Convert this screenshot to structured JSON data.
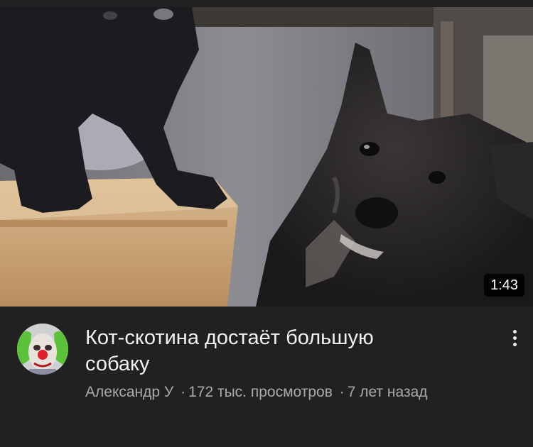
{
  "video": {
    "title": "Кот-скотина достаёт большую собаку",
    "duration": "1:43",
    "channel": "Александр У",
    "separator": "·",
    "views": "172 тыс. просмотров",
    "age": "7 лет назад"
  },
  "icons": {
    "menu": "more-vert-icon",
    "avatar": "channel-avatar"
  },
  "colors": {
    "background": "#212121",
    "title": "#f1f1f1",
    "secondary_text": "#aaaaaa",
    "badge_background": "#000000"
  }
}
